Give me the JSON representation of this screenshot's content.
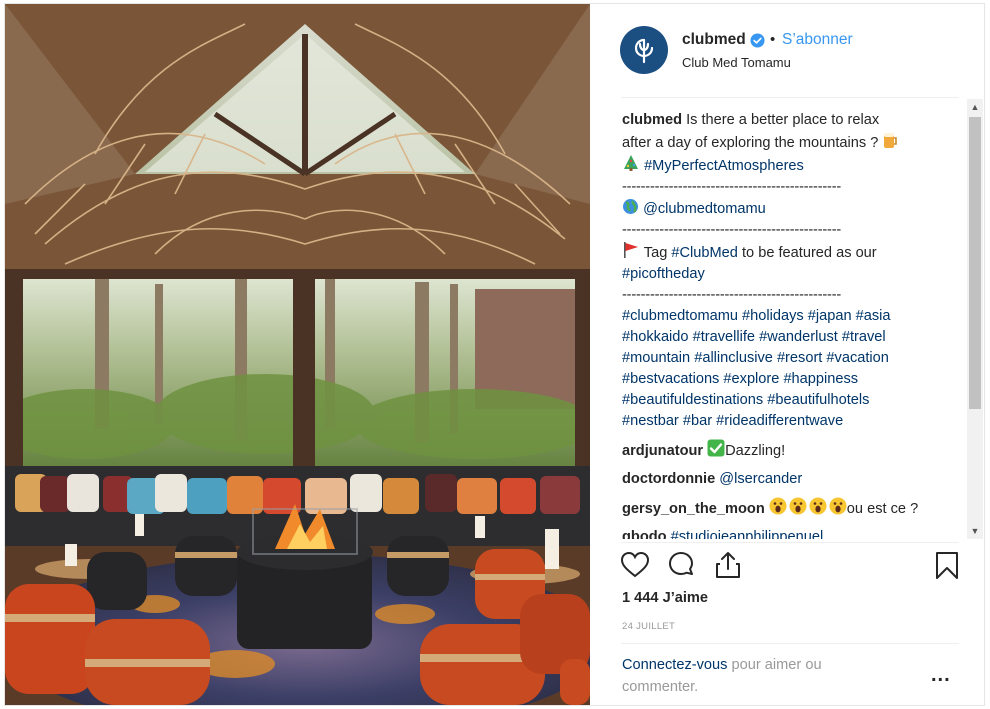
{
  "post": {
    "username": "clubmed",
    "dot": "•",
    "follow_label": "S’abonner",
    "location": "Club Med Tomamu",
    "caption": {
      "line1": "Is there a better place to relax",
      "line2": "after a day of exploring the mountains ?",
      "hashtag_atmos": "#MyPerfectAtmospheres",
      "separator": "-----------------------------------------------",
      "mention": "@clubmedtomamu",
      "tag_prefix": "Tag ",
      "tag_hashtag": "#ClubMed",
      "tag_suffix": " to be featured as our",
      "picoftheday": "#picoftheday",
      "hashtag_lines": [
        "#clubmedtomamu #holidays #japan #asia",
        "#hokkaido #travellife #wanderlust #travel",
        "#mountain #allinclusive #resort #vacation",
        "#bestvacations #explore #happiness",
        "#beautifuldestinations #beautifulhotels",
        "#nestbar #bar #rideadifferentwave"
      ]
    },
    "comments": [
      {
        "user": "ardjunatour",
        "text": "Dazzling!"
      },
      {
        "user": "doctordonnie",
        "text": "@lsercander"
      },
      {
        "user": "gersy_on_the_moon",
        "text": "ou est ce ?"
      },
      {
        "user": "gbodo",
        "text": "#studiojeanphilippenuel"
      }
    ],
    "likes": "1 444 J’aime",
    "date": "24 JUILLET",
    "login_link": "Connectez-vous",
    "login_text": " pour aimer ou commenter.",
    "more_label": "...",
    "colors": {
      "link_blue": "#003569",
      "follow_blue": "#3897f0",
      "avatar_bg": "#1b4f82",
      "text": "#262626",
      "muted": "#999999"
    },
    "icons": [
      "clubmed-logo-icon",
      "verified-badge-icon",
      "beer-mug-icon",
      "christmas-tree-icon",
      "globe-icon",
      "red-flag-icon",
      "check-mark-icon",
      "face-screaming-icon",
      "heart-icon",
      "comment-icon",
      "share-icon",
      "bookmark-icon"
    ]
  }
}
